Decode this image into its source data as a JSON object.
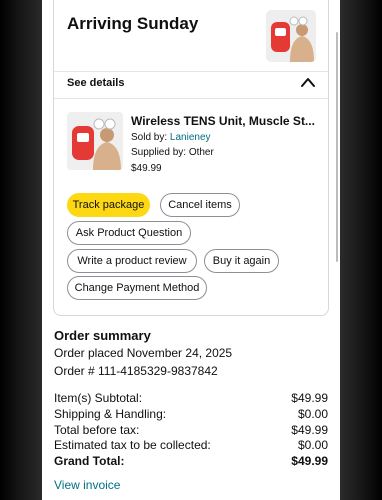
{
  "delivery": {
    "heading": "Arriving Sunday",
    "details_label": "See details"
  },
  "product": {
    "title": "Wireless TENS Unit, Muscle St...",
    "sold_by_prefix": "Sold by: ",
    "seller": "Lanieney",
    "supplied_by": "Supplied by: Other",
    "price": "$49.99"
  },
  "actions": {
    "track": "Track package",
    "cancel": "Cancel items",
    "ask": "Ask Product Question",
    "review": "Write a product review",
    "buy_again": "Buy it again",
    "payment": "Change Payment Method"
  },
  "summary": {
    "title": "Order summary",
    "placed": "Order placed November 24, 2025",
    "order_number": "Order # 111-4185329-9837842",
    "rows": [
      {
        "label": "Item(s) Subtotal:",
        "value": "$49.99"
      },
      {
        "label": "Shipping & Handling:",
        "value": "$0.00"
      },
      {
        "label": "Total before tax:",
        "value": "$49.99"
      },
      {
        "label": "Estimated tax to be collected:",
        "value": "$0.00"
      },
      {
        "label": "Grand Total:",
        "value": "$49.99"
      }
    ],
    "invoice_link": "View invoice"
  },
  "colors": {
    "primary_button": "#ffd814",
    "link": "#007185",
    "text": "#0f1111",
    "border": "#d5d9d9"
  },
  "icons": {
    "collapse": "chevron-up-icon",
    "thumbnail": "product-image"
  }
}
